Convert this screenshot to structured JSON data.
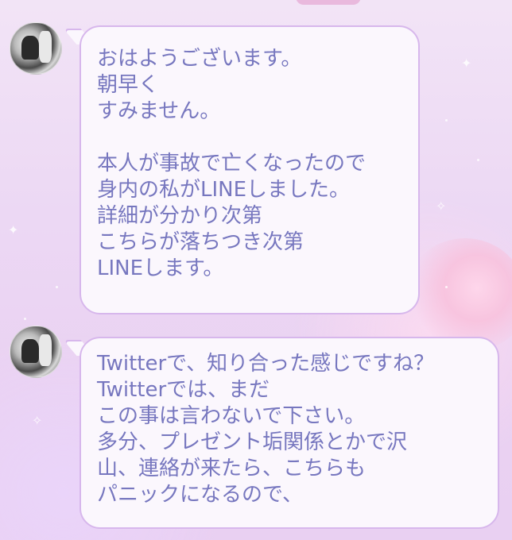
{
  "chat": {
    "messages": [
      {
        "sender_avatar": "avatar-photo",
        "lines": [
          "おはようございます。",
          "朝早く",
          "すみません。",
          "",
          "本人が事故で亡くなったので",
          "身内の私がLINEしました。",
          "詳細が分かり次第",
          "こちらが落ちつき次第",
          "LINEします。"
        ]
      },
      {
        "sender_avatar": "avatar-photo",
        "lines": [
          "Twitterで、知り合った感じですね？",
          "Twitterでは、まだ",
          "この事は言わないで下さい。",
          "多分、プレゼント垢関係とかで沢",
          "山、連絡が来たら、こちらも",
          "パニックになるので、"
        ]
      }
    ]
  },
  "colors": {
    "bubble_fill": "#fbf7fd",
    "bubble_border": "#d7b7ec",
    "text": "#7777bf",
    "background": "#ecd8f4"
  }
}
